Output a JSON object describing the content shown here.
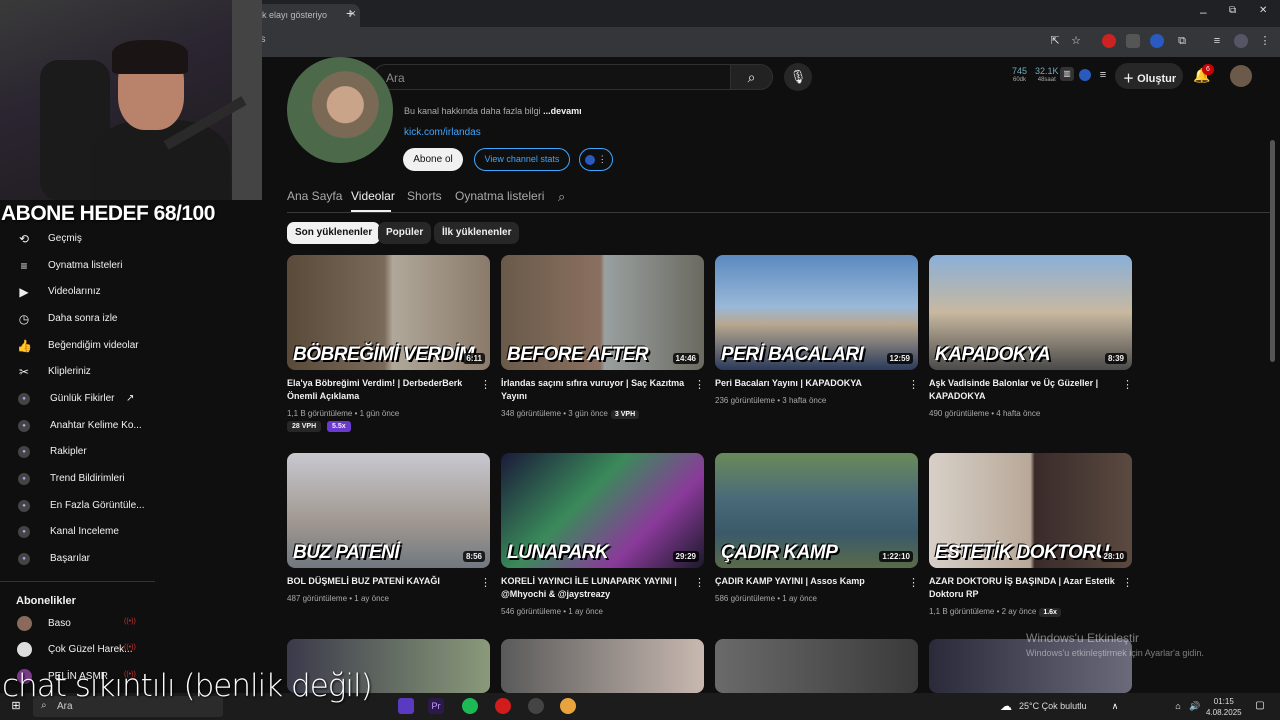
{
  "browser": {
    "tab_title": "k elayı gösteriyo",
    "url_fragment": "os",
    "new_tab": "+",
    "window": {
      "min": "–",
      "restore": "⧉",
      "close": "✕"
    }
  },
  "header": {
    "search_placeholder": "Ara",
    "stats": [
      {
        "value": "745",
        "label": "60dk"
      },
      {
        "value": "32.1K",
        "label": "48saat"
      }
    ],
    "create_label": "Oluştur",
    "notif_count": "6"
  },
  "overlay": {
    "goal_text": "ABONE HEDEF 68/100",
    "chat_note": "chat sıkıntılı (benlik değil)",
    "activate_title": "Windows'u Etkinleştir",
    "activate_sub": "Windows'u etkinleştirmek için Ayarlar'a gidin."
  },
  "sidebar": {
    "items": [
      {
        "label": "Geçmiş",
        "icon": "history-icon",
        "glyph": "⟲"
      },
      {
        "label": "Oynatma listeleri",
        "icon": "playlist-icon",
        "glyph": "≡"
      },
      {
        "label": "Videolarınız",
        "icon": "your-videos-icon",
        "glyph": "▶"
      },
      {
        "label": "Daha sonra izle",
        "icon": "watch-later-icon",
        "glyph": "◷"
      },
      {
        "label": "Beğendiğim videolar",
        "icon": "like-icon",
        "glyph": "👍"
      },
      {
        "label": "Klipleriniz",
        "icon": "clips-icon",
        "glyph": "✂"
      }
    ],
    "tools": [
      {
        "label": "Günlük Fikirler",
        "external": "↗"
      },
      {
        "label": "Anahtar Kelime Ko..."
      },
      {
        "label": "Rakipler"
      },
      {
        "label": "Trend Bildirimleri"
      },
      {
        "label": "En Fazla Görüntüle..."
      },
      {
        "label": "Kanal Inceleme"
      },
      {
        "label": "Başarılar"
      }
    ],
    "subs_heading": "Abonelikler",
    "subs": [
      {
        "label": "Baso",
        "color": "#8a6a5a"
      },
      {
        "label": "Çok Güzel Harek...",
        "color": "#ddd"
      },
      {
        "label": "PELİN ASMR",
        "color": "#7a3a8a"
      }
    ]
  },
  "channel": {
    "about_text": "Bu kanal hakkında daha fazla bilgi",
    "about_more": "...devamı",
    "link": "kick.com/irlandas",
    "subscribe": "Abone ol",
    "view_stats": "View channel stats",
    "tabs": [
      "Ana Sayfa",
      "Videolar",
      "Shorts",
      "Oynatma listeleri"
    ],
    "chips": [
      "Son yüklenenler",
      "Popüler",
      "İlk yüklenenler"
    ]
  },
  "videos": [
    {
      "thumb_text": "BÖBREĞİMİ VERDİM",
      "duration": "6:11",
      "title": "Ela'ya Böbreğimi Verdim! | DerbederBerk Önemli Açıklama",
      "meta": "1,1 B görüntüleme • 1 gün önce",
      "badge_a": "28 VPH",
      "badge_b": "5.5x",
      "bg": "linear-gradient(90deg,#5a4a3a 0%,#7a6a5a 48%,#b0a89a 52%,#8a7a6a 100%)"
    },
    {
      "thumb_text": "BEFORE      AFTER",
      "duration": "14:46",
      "title": "İrlandas saçını sıfıra vuruyor | Saç Kazıtma Yayını",
      "meta": "348 görüntüleme • 3 gün önce",
      "badge_inline": "3 VPH",
      "bg": "linear-gradient(90deg,#6a5a4a 0%,#8a7060 49%,#9aa0a0 51%,#6a6a60 100%)"
    },
    {
      "thumb_text": "PERİ BACALARI",
      "duration": "12:59",
      "title": "Peri Bacaları Yayını | KAPADOKYA",
      "meta": "236 görüntüleme • 3 hafta önce",
      "bg": "linear-gradient(180deg,#5a8ac0 0%,#9ab8d8 45%,#b8a890 60%,#2a3a5a 100%)"
    },
    {
      "thumb_text": "KAPADOKYA",
      "duration": "8:39",
      "title": "Aşk Vadisinde Balonlar ve Üç Güzeller | KAPADOKYA",
      "meta": "490 görüntüleme • 4 hafta önce",
      "bg": "linear-gradient(180deg,#8ab0d8 0%,#c8b8a0 50%,#4a4a4a 100%)"
    },
    {
      "thumb_text": "BUZ PATENİ",
      "duration": "8:56",
      "title": "BOL DÜŞMELİ BUZ PATENİ KAYAĞI",
      "meta": "487 görüntüleme • 1 ay önce",
      "bg": "linear-gradient(180deg,#c8c8d0 0%,#a09890 60%,#707880 100%)"
    },
    {
      "thumb_text": "LUNAPARK",
      "duration": "29:29",
      "title": "KORELİ YAYINCI İLE LUNAPARK YAYINI | @Mhyochi & @jaystreazy",
      "meta": "546 görüntüleme • 1 ay önce",
      "bg": "linear-gradient(135deg,#1a1a3a 0%,#3a8a5a 40%,#8a3a9a 70%,#1a1a2a 100%)"
    },
    {
      "thumb_text": "ÇADIR KAMP",
      "duration": "1:22:10",
      "title": "ÇADIR KAMP YAYINI | Assos Kamp",
      "meta": "586 görüntüleme • 1 ay önce",
      "bg": "linear-gradient(180deg,#6a8a5a 0%,#4a6a7a 40%,#3a5a6a 70%,#5a6a4a 100%)"
    },
    {
      "thumb_text": "ESTETİK DOKTORU",
      "duration": "28:10",
      "title": "AZAR DOKTORU İŞ BAŞINDA | Azar Estetik Doktoru RP",
      "meta": "1,1 B görüntüleme • 2 ay önce",
      "badge_inline": "1.6x",
      "bg": "linear-gradient(90deg,#d8d0c8 0%,#b8a898 50%,#3a2a2a 52%,#5a4a40 100%)"
    }
  ],
  "taskbar": {
    "search": "Ara",
    "weather": "25°C  Çok bulutlu",
    "time": "01:15",
    "date": "4.08.2025"
  }
}
